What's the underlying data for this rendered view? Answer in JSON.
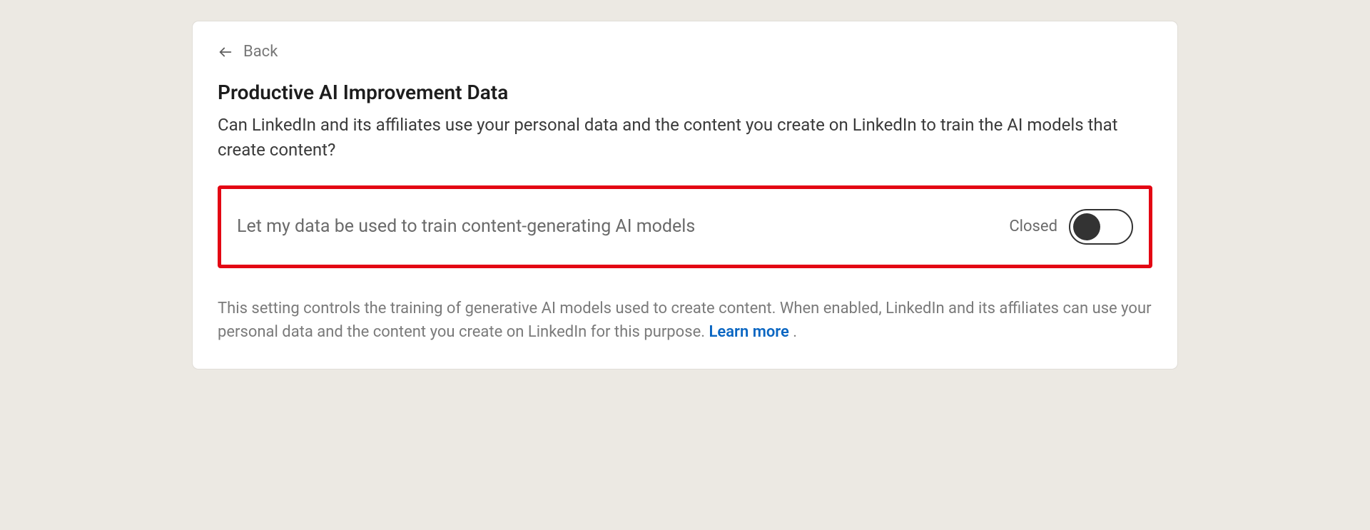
{
  "nav": {
    "back_label": "Back"
  },
  "header": {
    "title": "Productive AI Improvement Data",
    "description": "Can LinkedIn and its affiliates use your personal data and the content you create on LinkedIn to train the AI models that create content?"
  },
  "setting": {
    "toggle_label": "Let my data be used to train content-generating AI models",
    "status_text": "Closed",
    "toggle_state": "off"
  },
  "footer": {
    "explanation": "This setting controls the training of generative AI models used to create content. When enabled, LinkedIn and its affiliates can use your personal data and the content you create on LinkedIn for this purpose. ",
    "learn_more_label": "Learn more",
    "punctuation": " ."
  }
}
